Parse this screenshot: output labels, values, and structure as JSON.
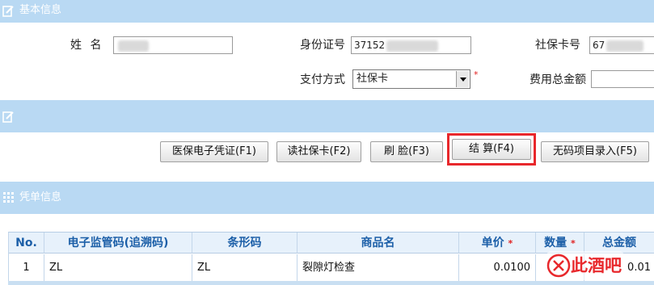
{
  "sections": {
    "basic_info": "基本信息",
    "voucher_info": "凭单信息"
  },
  "form": {
    "name_label": "姓  名",
    "name_value": "",
    "id_label": "身份证号",
    "id_value": "37152",
    "social_card_label": "社保卡号",
    "social_card_value": "67",
    "payment_label": "支付方式",
    "payment_value": "社保卡",
    "payment_required": "*",
    "total_fee_label": "费用总金额",
    "total_fee_value": ""
  },
  "actions": {
    "medical_voucher": "医保电子凭证(F1)",
    "read_card": "读社保卡(F2)",
    "face_scan": "刷  脸(F3)",
    "settle": "结    算(F4)",
    "no_code_entry": "无码项目录入(F5)"
  },
  "table": {
    "columns": {
      "no": "No.",
      "trace_code": "电子监管码(追溯码)",
      "barcode": "条形码",
      "product_name": "商品名",
      "unit_price": "单价",
      "quantity": "数量",
      "total_amount": "总金额"
    },
    "required_mark": "*",
    "rows": [
      {
        "no": "1",
        "trace_code": "ZL",
        "barcode": "ZL",
        "product_name": "裂隙灯检查",
        "unit_price": "0.0100",
        "quantity": "",
        "total_amount": "0.01"
      }
    ]
  },
  "watermark": "此酒吧",
  "colors": {
    "section_bar": "#b9d9f3",
    "header_text": "#1c5fa8",
    "highlight": "#e8282c"
  }
}
